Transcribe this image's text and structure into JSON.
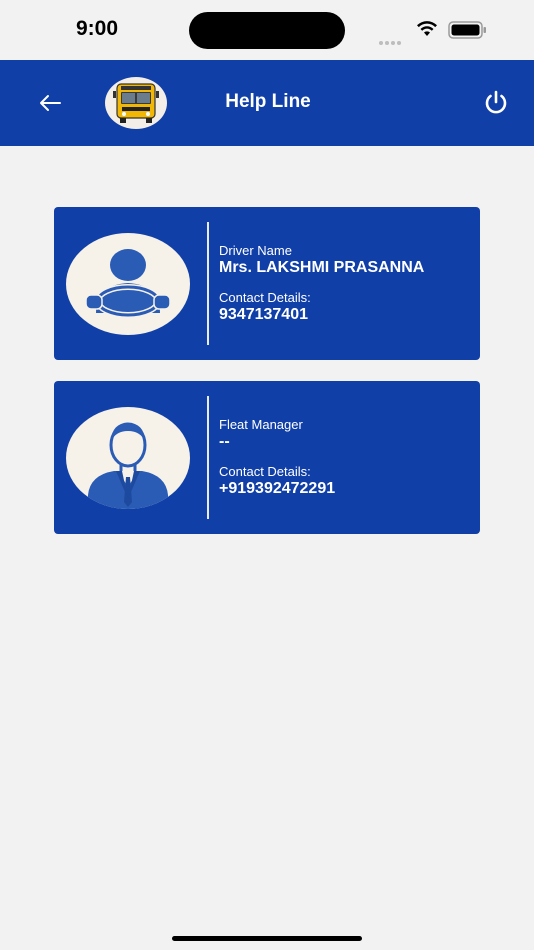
{
  "status_bar": {
    "time": "9:00"
  },
  "header": {
    "title": "Help Line"
  },
  "contacts": [
    {
      "role_label": "Driver Name",
      "name": "Mrs. LAKSHMI PRASANNA",
      "contact_label": "Contact Details:",
      "phone": "9347137401",
      "icon": "driver-icon"
    },
    {
      "role_label": "Fleat Manager",
      "name": "--",
      "contact_label": "Contact Details:",
      "phone": "+919392472291",
      "icon": "manager-icon"
    }
  ],
  "colors": {
    "primary": "#113fa8",
    "background": "#f2f2f2",
    "avatar_bg": "#f6f2ea",
    "icon_blue": "#2a5bb5"
  }
}
